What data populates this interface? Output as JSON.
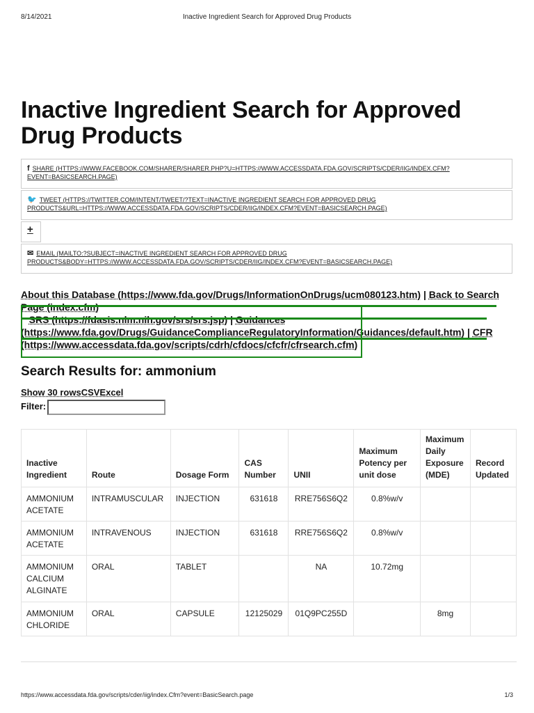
{
  "print_header": {
    "date": "8/14/2021",
    "title": "Inactive Ingredient Search for Approved Drug Products"
  },
  "page_title": "Inactive Ingredient Search for Approved Drug Products",
  "share": {
    "facebook": {
      "label": "SHARE",
      "url": "(HTTPS://WWW.FACEBOOK.COM/SHARER/SHARER.PHP?U=HTTPS://WWW.ACCESSDATA.FDA.GOV/SCRIPTS/CDER/IIG/INDEX.CFM?EVENT=BASICSEARCH.PAGE)"
    },
    "twitter": {
      "label": "TWEET",
      "url": "(HTTPS://TWITTER.COM/INTENT/TWEET/?TEXT=INACTIVE INGREDIENT SEARCH FOR APPROVED DRUG PRODUCTS&URL=HTTPS://WWW.ACCESSDATA.FDA.GOV/SCRIPTS/CDER/IIG/INDEX.CFM?EVENT=BASICSEARCH.PAGE)"
    },
    "plus": "+",
    "email": {
      "label": "EMAIL",
      "url": "(MAILTO:?SUBJECT=INACTIVE INGREDIENT SEARCH FOR APPROVED DRUG PRODUCTS&BODY=HTTPS://WWW.ACCESSDATA.FDA.GOV/SCRIPTS/CDER/IIG/INDEX.CFM?EVENT=BASICSEARCH.PAGE)"
    }
  },
  "links": [
    "About this Database (https://www.fda.gov/Drugs/InformationOnDrugs/ucm080123.htm)",
    "Back to Search Page (index.cfm)",
    "SRS (https://fdasis.nlm.nih.gov/srs/srs.jsp)",
    "Guidances (https://www.fda.gov/Drugs/GuidanceComplianceRegulatoryInformation/Guidances/default.htm)",
    "CFR (https://www.accessdata.fda.gov/scripts/cdrh/cfdocs/cfcfr/cfrsearch.cfm)"
  ],
  "separator": "|",
  "results_heading": "Search Results for: ammonium",
  "table_controls": {
    "show": "Show 30 rowsCSVExcel",
    "filter_label": "Filter:",
    "filter_value": ""
  },
  "table": {
    "headers": [
      "Inactive Ingredient",
      "Route",
      "Dosage Form",
      "CAS Number",
      "UNII",
      "Maximum Potency per unit dose",
      "Maximum Daily Exposure (MDE)",
      "Record Updated"
    ],
    "rows": [
      [
        "AMMONIUM ACETATE",
        "INTRAMUSCULAR",
        "INJECTION",
        "631618",
        "RRE756S6Q2",
        "0.8%w/v",
        "",
        ""
      ],
      [
        "AMMONIUM ACETATE",
        "INTRAVENOUS",
        "INJECTION",
        "631618",
        "RRE756S6Q2",
        "0.8%w/v",
        "",
        ""
      ],
      [
        "AMMONIUM CALCIUM ALGINATE",
        "ORAL",
        "TABLET",
        "",
        "NA",
        "10.72mg",
        "",
        ""
      ],
      [
        "AMMONIUM CHLORIDE",
        "ORAL",
        "CAPSULE",
        "12125029",
        "01Q9PC255D",
        "",
        "8mg",
        ""
      ]
    ]
  },
  "print_footer": {
    "url": "https://www.accessdata.fda.gov/scripts/cder/iig/index.Cfm?event=BasicSearch.page",
    "page": "1/3"
  },
  "colors": {
    "annotation_green": "#1a8a1a"
  }
}
